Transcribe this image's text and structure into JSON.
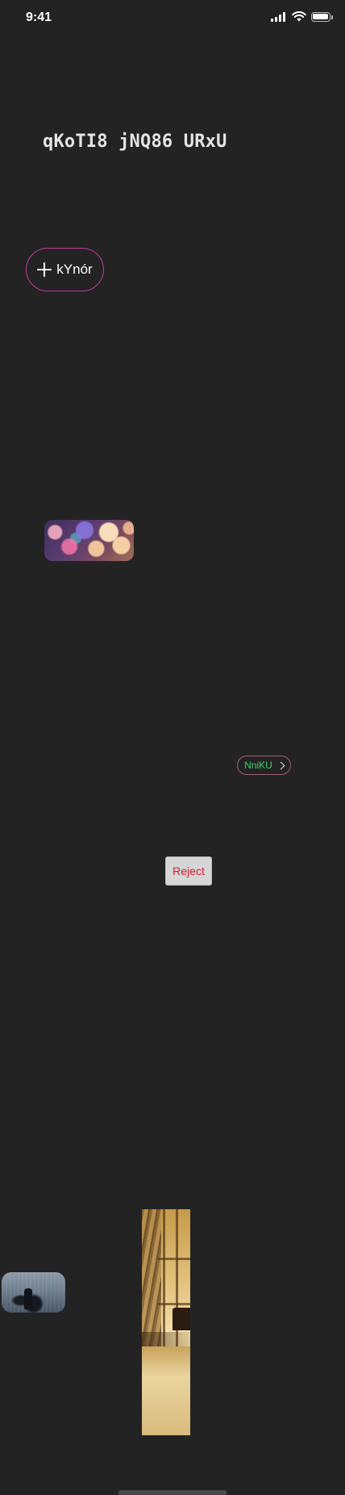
{
  "status_bar": {
    "time": "9:41",
    "icons": [
      "signal-icon",
      "wifi-icon",
      "battery-icon"
    ]
  },
  "header": {
    "title": "qKoTI8 jNQ86 URxU"
  },
  "actions": {
    "add_label": "kYnór",
    "link_label": "NniKU",
    "reject_label": "Reject"
  },
  "images": [
    {
      "name": "bokeh-lights-image"
    },
    {
      "name": "snowy-figure-image"
    },
    {
      "name": "sunlit-window-image"
    }
  ],
  "colors": {
    "background": "#232323",
    "add_button_border": "#c2379f",
    "link_text": "#3ed16b",
    "link_border": "#a35d75",
    "reject_text": "#cc1f2c",
    "reject_background": "#d6d6d6"
  }
}
